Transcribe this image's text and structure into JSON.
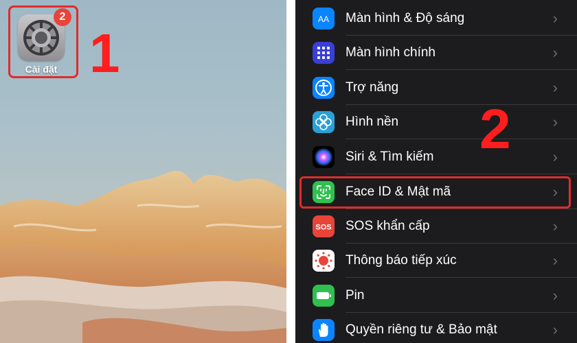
{
  "home": {
    "app_label": "Cài đặt",
    "badge_count": "2",
    "step_number": "1"
  },
  "settings": {
    "step_number": "2",
    "items": [
      {
        "label": "Màn hình & Độ sáng",
        "icon": "display-brightness-icon",
        "color": "#0a84ff"
      },
      {
        "label": "Màn hình chính",
        "icon": "home-screen-icon",
        "color": "#3a3fd6"
      },
      {
        "label": "Trợ năng",
        "icon": "accessibility-icon",
        "color": "#0a84ff"
      },
      {
        "label": "Hình nền",
        "icon": "wallpaper-flower-icon",
        "color": "#2aa0d8"
      },
      {
        "label": "Siri & Tìm kiếm",
        "icon": "siri-icon",
        "color": "#000000"
      },
      {
        "label": "Face ID & Mật mã",
        "icon": "face-id-icon",
        "color": "#30c04f"
      },
      {
        "label": "SOS khẩn cấp",
        "icon": "sos-icon",
        "color": "#e8443a"
      },
      {
        "label": "Thông báo tiếp xúc",
        "icon": "exposure-notification-icon",
        "color": "#ffffff"
      },
      {
        "label": "Pin",
        "icon": "battery-icon",
        "color": "#30c04f"
      },
      {
        "label": "Quyền riêng tư & Bảo mật",
        "icon": "privacy-hand-icon",
        "color": "#0a84ff"
      }
    ],
    "chevron": "›"
  }
}
